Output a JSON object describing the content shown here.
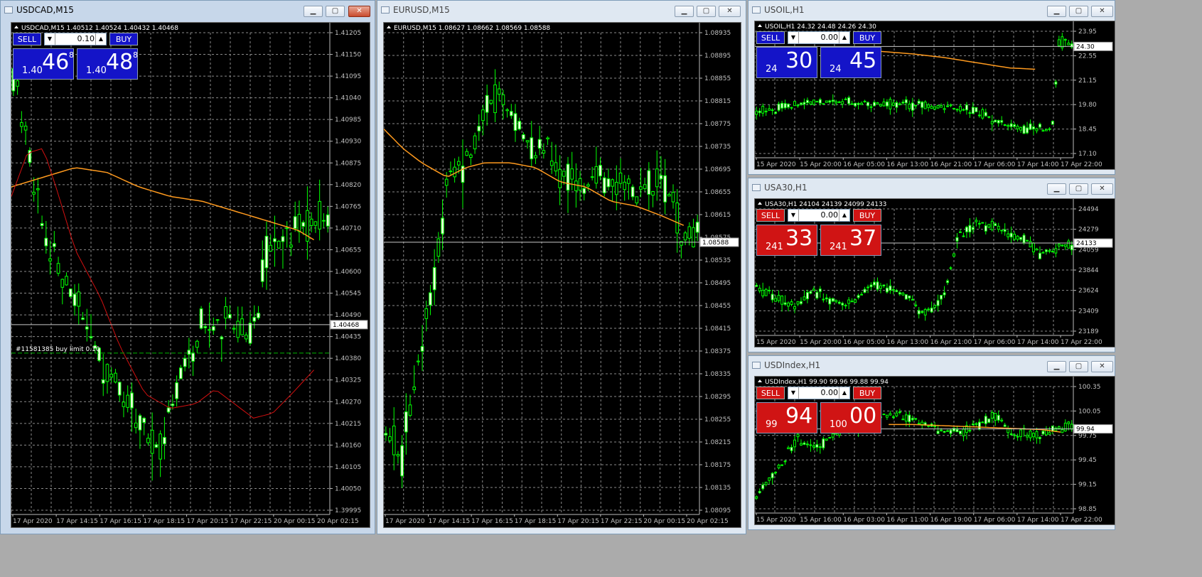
{
  "windows": [
    {
      "id": "usdcad",
      "title": "USDCAD,M15",
      "header": "USDCAD,M15  1.40512 1.40524 1.40432 1.40468",
      "active": true,
      "color_scheme": "blue",
      "panel": {
        "sell_label": "SELL",
        "buy_label": "BUY",
        "volume": "0.10",
        "sell_small": "1.40",
        "sell_big": "46",
        "sell_sup": "8",
        "buy_small": "1.40",
        "buy_big": "48",
        "buy_sup": "8"
      },
      "price_labels": [
        "1.41205",
        "1.41150",
        "1.41095",
        "1.41040",
        "1.40985",
        "1.40930",
        "1.40875",
        "1.40820",
        "1.40765",
        "1.40710",
        "1.40655",
        "1.40600",
        "1.40545",
        "1.40490",
        "1.40435",
        "1.40380",
        "1.40325",
        "1.40270",
        "1.40215",
        "1.40160",
        "1.40105",
        "1.40050",
        "1.39995"
      ],
      "time_labels": [
        "17 Apr 2020",
        "17 Apr 14:15",
        "17 Apr 16:15",
        "17 Apr 18:15",
        "17 Apr 20:15",
        "17 Apr 22:15",
        "20 Apr 00:15",
        "20 Apr 02:15"
      ],
      "current_price": "1.40468",
      "order_label": "#11581385 buy limit 0.10"
    },
    {
      "id": "eurusd",
      "title": "EURUSD,M15",
      "header": "EURUSD,M15  1.08627 1.08662 1.08569 1.08588",
      "active": false,
      "color_scheme": "none",
      "price_labels": [
        "1.08935",
        "1.08895",
        "1.08855",
        "1.08815",
        "1.08775",
        "1.08735",
        "1.08695",
        "1.08655",
        "1.08615",
        "1.08575",
        "1.08535",
        "1.08495",
        "1.08455",
        "1.08415",
        "1.08375",
        "1.08335",
        "1.08295",
        "1.08255",
        "1.08215",
        "1.08175",
        "1.08135",
        "1.08095"
      ],
      "time_labels": [
        "17 Apr 2020",
        "17 Apr 14:15",
        "17 Apr 16:15",
        "17 Apr 18:15",
        "17 Apr 20:15",
        "17 Apr 22:15",
        "20 Apr 00:15",
        "20 Apr 02:15"
      ],
      "current_price": "1.08588"
    },
    {
      "id": "usoil",
      "title": "USOIL,H1",
      "header": "USOIL,H1  24.32 24.48 24.26 24.30",
      "active": false,
      "color_scheme": "blue",
      "panel": {
        "sell_label": "SELL",
        "buy_label": "BUY",
        "volume": "0.00",
        "sell_small": "24",
        "sell_big": "30",
        "sell_sup": "",
        "buy_small": "24",
        "buy_big": "45",
        "buy_sup": ""
      },
      "price_labels": [
        "23.95",
        "22.55",
        "21.15",
        "19.80",
        "18.45",
        "17.10"
      ],
      "time_labels": [
        "15 Apr 2020",
        "15 Apr 20:00",
        "16 Apr 05:00",
        "16 Apr 13:00",
        "16 Apr 21:00",
        "17 Apr 06:00",
        "17 Apr 14:00",
        "17 Apr 22:00"
      ],
      "current_price": "24.30"
    },
    {
      "id": "usa30",
      "title": "USA30,H1",
      "header": "USA30,H1  24104 24139 24099 24133",
      "active": false,
      "color_scheme": "red",
      "panel": {
        "sell_label": "SELL",
        "buy_label": "BUY",
        "volume": "0.00",
        "sell_small": "241",
        "sell_big": "33",
        "sell_sup": "",
        "buy_small": "241",
        "buy_big": "37",
        "buy_sup": ""
      },
      "price_labels": [
        "24494",
        "24279",
        "24059",
        "23844",
        "23624",
        "23409",
        "23189"
      ],
      "time_labels": [
        "15 Apr 2020",
        "15 Apr 20:00",
        "16 Apr 05:00",
        "16 Apr 13:00",
        "16 Apr 21:00",
        "17 Apr 06:00",
        "17 Apr 14:00",
        "17 Apr 22:00"
      ],
      "current_price": "24133"
    },
    {
      "id": "usdindex",
      "title": "USDIndex,H1",
      "header": "USDIndex,H1  99.90 99.96 99.88 99.94",
      "active": false,
      "color_scheme": "red",
      "panel": {
        "sell_label": "SELL",
        "buy_label": "BUY",
        "volume": "0.00",
        "sell_small": "99",
        "sell_big": "94",
        "sell_sup": "",
        "buy_small": "100",
        "buy_big": "00",
        "buy_sup": ""
      },
      "price_labels": [
        "100.35",
        "100.05",
        "99.75",
        "99.45",
        "99.15",
        "98.85"
      ],
      "time_labels": [
        "15 Apr 2020",
        "15 Apr 16:00",
        "16 Apr 03:00",
        "16 Apr 11:00",
        "16 Apr 19:00",
        "17 Apr 06:00",
        "17 Apr 14:00",
        "17 Apr 22:00"
      ],
      "current_price": "99.94"
    }
  ],
  "colors": {
    "candle_up_body": "#f0ffe0",
    "candle_wick": "#00ff00",
    "ma_orange": "#ff9a1e",
    "ma_red": "#d21010",
    "grid": "#8a8a8a",
    "chart_bg": "#000000",
    "panel_blue": "#1414c8",
    "panel_red": "#d01414"
  }
}
